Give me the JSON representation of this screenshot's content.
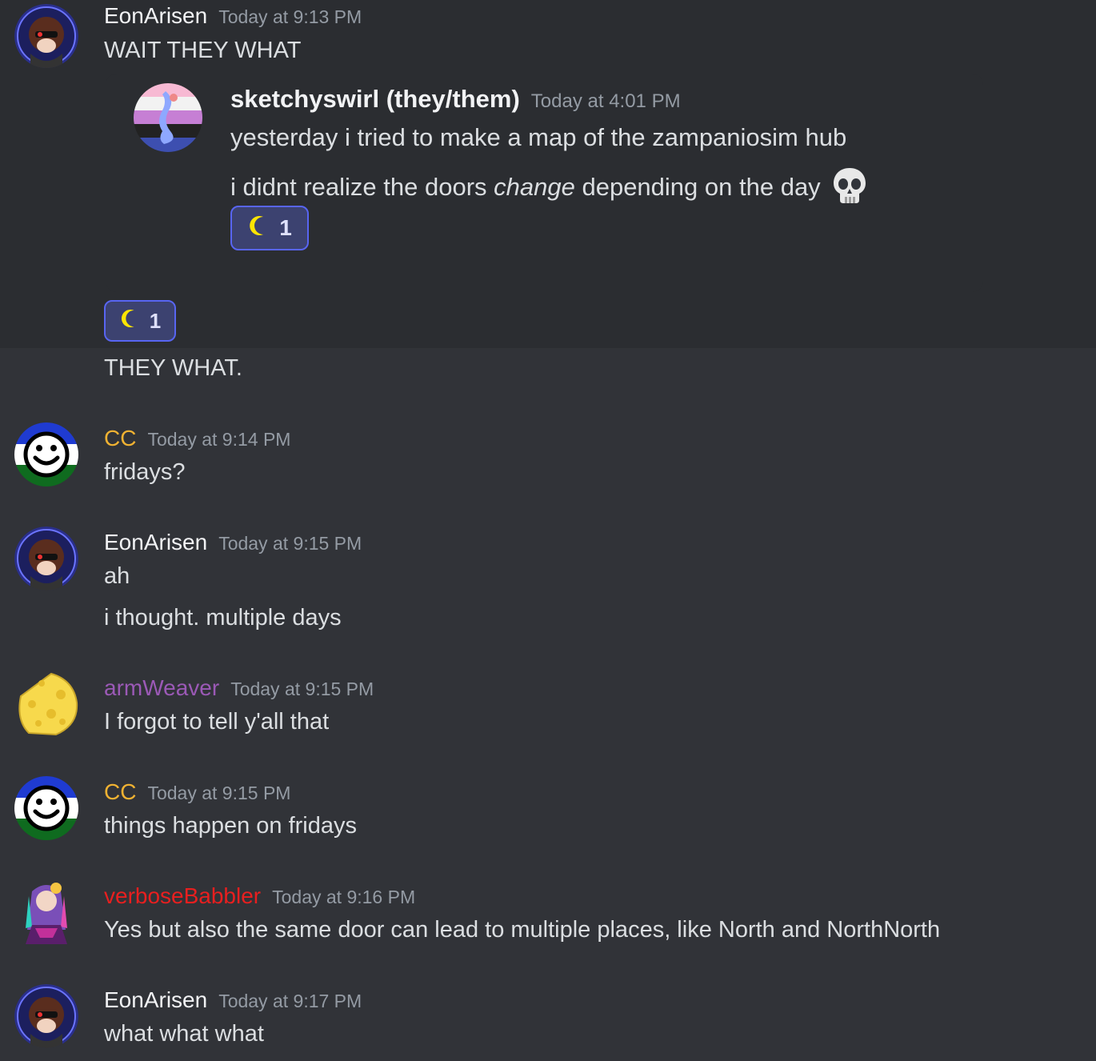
{
  "messages": [
    {
      "author": "EonArisen",
      "author_color": "#f2f3f5",
      "timestamp": "Today at 9:13 PM",
      "lines": [
        "WAIT THEY WHAT"
      ],
      "forward": {
        "author": "sketchyswirl (they/them)",
        "timestamp": "Today at 4:01 PM",
        "line1": "yesterday i tried to make a map of the zampaniosim hub",
        "line2_before": "i didnt realize the doors ",
        "line2_italic": "change",
        "line2_after": " depending on the day",
        "emoji_icon": "skull-icon",
        "reaction": {
          "emoji": "crescent-moon-icon",
          "count": "1"
        }
      },
      "reaction": {
        "emoji": "crescent-moon-icon",
        "count": "1"
      },
      "followup": "THEY WHAT."
    },
    {
      "author": "CC",
      "author_color": "#f0b232",
      "timestamp": "Today at 9:14 PM",
      "lines": [
        "fridays?"
      ]
    },
    {
      "author": "EonArisen",
      "author_color": "#f2f3f5",
      "timestamp": "Today at 9:15 PM",
      "lines": [
        "ah",
        "i thought. multiple days"
      ]
    },
    {
      "author": "armWeaver",
      "author_color": "#9b59b6",
      "timestamp": "Today at 9:15 PM",
      "lines": [
        "I forgot to tell y'all that"
      ]
    },
    {
      "author": "CC",
      "author_color": "#f0b232",
      "timestamp": "Today at 9:15 PM",
      "lines": [
        "things happen on fridays"
      ]
    },
    {
      "author": "verboseBabbler",
      "author_color": "#e81f1f",
      "timestamp": "Today at 9:16 PM",
      "lines": [
        "Yes but also the same door can lead to multiple places, like North and NorthNorth"
      ]
    },
    {
      "author": "EonArisen",
      "author_color": "#f2f3f5",
      "timestamp": "Today at 9:17 PM",
      "lines": [
        "what what what"
      ]
    }
  ]
}
